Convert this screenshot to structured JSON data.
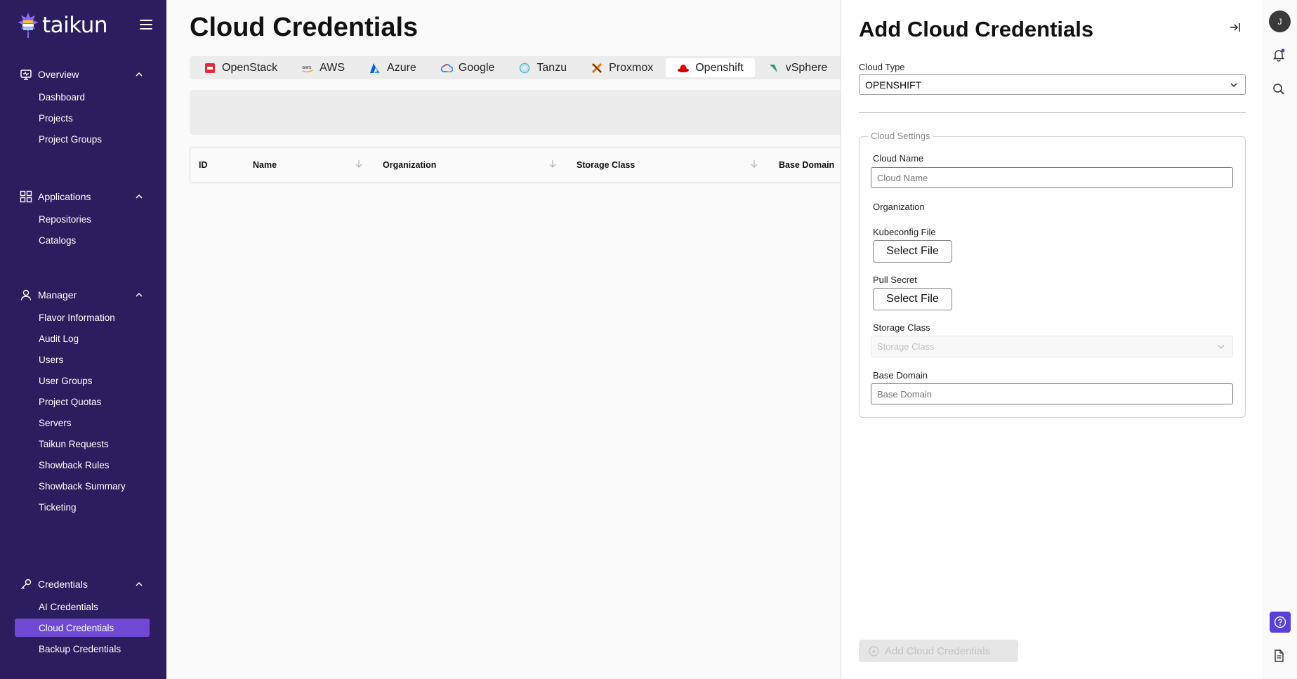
{
  "app": {
    "logo_text": "taikun"
  },
  "sidebar": {
    "sections": [
      {
        "title": "Overview",
        "items": [
          "Dashboard",
          "Projects",
          "Project Groups"
        ]
      },
      {
        "title": "Applications",
        "items": [
          "Repositories",
          "Catalogs"
        ]
      },
      {
        "title": "Manager",
        "items": [
          "Flavor Information",
          "Audit Log",
          "Users",
          "User Groups",
          "Project Quotas",
          "Servers",
          "Taikun Requests",
          "Showback Rules",
          "Showback Summary",
          "Ticketing"
        ]
      },
      {
        "title": "Credentials",
        "items": [
          "AI Credentials",
          "Cloud Credentials",
          "Backup Credentials"
        ]
      }
    ],
    "active_item": "Cloud Credentials"
  },
  "main": {
    "title": "Cloud Credentials",
    "tabs": [
      "OpenStack",
      "AWS",
      "Azure",
      "Google",
      "Tanzu",
      "Proxmox",
      "Openshift",
      "vSphere"
    ],
    "active_tab": "Openshift",
    "table_headers": [
      "ID",
      "Name",
      "Organization",
      "Storage Class",
      "Base Domain"
    ]
  },
  "drawer": {
    "title": "Add Cloud Credentials",
    "cloud_type_label": "Cloud Type",
    "cloud_type_value": "OPENSHIFT",
    "settings_legend": "Cloud Settings",
    "cloud_name_label": "Cloud Name",
    "cloud_name_placeholder": "Cloud Name",
    "organization_label": "Organization",
    "kubeconfig_label": "Kubeconfig File",
    "kubeconfig_button": "Select File",
    "pull_secret_label": "Pull Secret",
    "pull_secret_button": "Select File",
    "storage_class_label": "Storage Class",
    "storage_class_placeholder": "Storage Class",
    "base_domain_label": "Base Domain",
    "base_domain_placeholder": "Base Domain",
    "submit_label": "Add Cloud Credentials"
  },
  "rail": {
    "avatar_initial": "J"
  },
  "colors": {
    "sidebar_bg": "#2b1d5e",
    "accent": "#6e4ad4",
    "help_bg": "#5b3fd6"
  }
}
